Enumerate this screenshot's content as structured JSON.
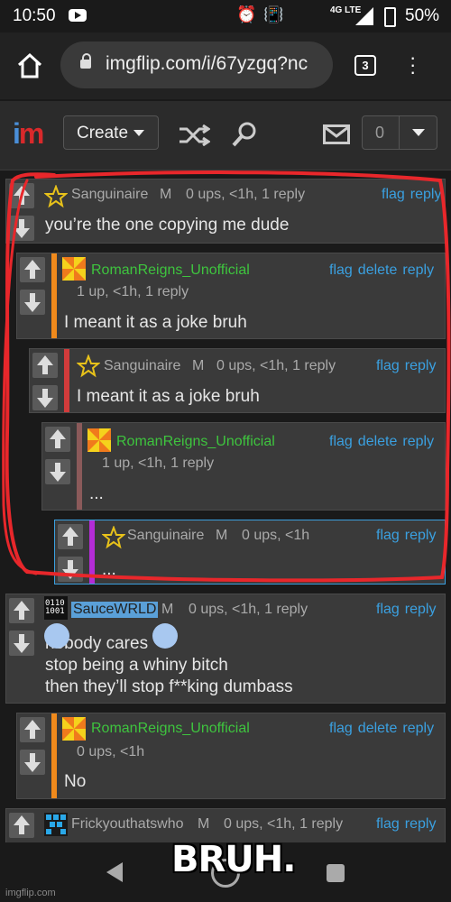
{
  "status_bar": {
    "time": "10:50",
    "network": "4G LTE",
    "battery": "50%"
  },
  "browser": {
    "url": "imgflip.com/i/67yzgq?nc",
    "tab_count": "3"
  },
  "header": {
    "create_label": "Create",
    "notification_count": "0"
  },
  "comments": [
    {
      "user": "Sanguinaire",
      "mod": "M",
      "meta": "0 ups, <1h, 1 reply",
      "actions": [
        "flag",
        "reply"
      ],
      "text": "you’re the one copying me dude"
    },
    {
      "user": "RomanReigns_Unofficial",
      "meta": "1 up, <1h, 1 reply",
      "actions": [
        "flag",
        "delete",
        "reply"
      ],
      "text": "I meant it as a joke bruh"
    },
    {
      "user": "Sanguinaire",
      "mod": "M",
      "meta": "0 ups, <1h, 1 reply",
      "actions": [
        "flag",
        "reply"
      ],
      "text": "I meant it as a joke bruh"
    },
    {
      "user": "RomanReigns_Unofficial",
      "meta": "1 up, <1h, 1 reply",
      "actions": [
        "flag",
        "delete",
        "reply"
      ],
      "text": "..."
    },
    {
      "user": "Sanguinaire",
      "mod": "M",
      "meta": "0 ups, <1h",
      "actions": [
        "flag",
        "reply"
      ],
      "text": "..."
    },
    {
      "user": "SauceWRLD",
      "mod": "M",
      "meta": "0 ups, <1h, 1 reply",
      "actions": [
        "flag",
        "reply"
      ],
      "text_lines": [
        "nobody cares",
        "stop being a whiny bitch",
        "then they’ll stop f**king dumbass"
      ]
    },
    {
      "user": "RomanReigns_Unofficial",
      "meta": "0 ups, <1h",
      "actions": [
        "flag",
        "delete",
        "reply"
      ],
      "text": "No"
    },
    {
      "user": "Frickyouthatswho",
      "mod": "M",
      "meta": "0 ups, <1h, 1 reply",
      "actions": [
        "flag",
        "reply"
      ]
    }
  ],
  "overlay": {
    "caption": "BRUH.",
    "watermark": "imgflip.com"
  },
  "colors": {
    "green_user": "#3ec43e",
    "link_blue": "#3aa0e0",
    "red_annotation": "#e8272b",
    "stripe_orange": "#f08a1c",
    "stripe_red": "#d13b3b",
    "stripe_brown": "#8b5a5a",
    "stripe_purple": "#b42cd6"
  }
}
